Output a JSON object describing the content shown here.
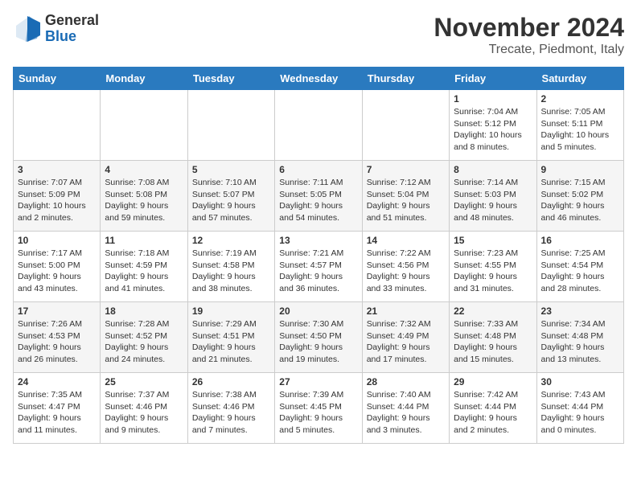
{
  "header": {
    "logo_line1": "General",
    "logo_line2": "Blue",
    "month_title": "November 2024",
    "location": "Trecate, Piedmont, Italy"
  },
  "days_of_week": [
    "Sunday",
    "Monday",
    "Tuesday",
    "Wednesday",
    "Thursday",
    "Friday",
    "Saturday"
  ],
  "weeks": [
    [
      {
        "day": "",
        "info": ""
      },
      {
        "day": "",
        "info": ""
      },
      {
        "day": "",
        "info": ""
      },
      {
        "day": "",
        "info": ""
      },
      {
        "day": "",
        "info": ""
      },
      {
        "day": "1",
        "info": "Sunrise: 7:04 AM\nSunset: 5:12 PM\nDaylight: 10 hours and 8 minutes."
      },
      {
        "day": "2",
        "info": "Sunrise: 7:05 AM\nSunset: 5:11 PM\nDaylight: 10 hours and 5 minutes."
      }
    ],
    [
      {
        "day": "3",
        "info": "Sunrise: 7:07 AM\nSunset: 5:09 PM\nDaylight: 10 hours and 2 minutes."
      },
      {
        "day": "4",
        "info": "Sunrise: 7:08 AM\nSunset: 5:08 PM\nDaylight: 9 hours and 59 minutes."
      },
      {
        "day": "5",
        "info": "Sunrise: 7:10 AM\nSunset: 5:07 PM\nDaylight: 9 hours and 57 minutes."
      },
      {
        "day": "6",
        "info": "Sunrise: 7:11 AM\nSunset: 5:05 PM\nDaylight: 9 hours and 54 minutes."
      },
      {
        "day": "7",
        "info": "Sunrise: 7:12 AM\nSunset: 5:04 PM\nDaylight: 9 hours and 51 minutes."
      },
      {
        "day": "8",
        "info": "Sunrise: 7:14 AM\nSunset: 5:03 PM\nDaylight: 9 hours and 48 minutes."
      },
      {
        "day": "9",
        "info": "Sunrise: 7:15 AM\nSunset: 5:02 PM\nDaylight: 9 hours and 46 minutes."
      }
    ],
    [
      {
        "day": "10",
        "info": "Sunrise: 7:17 AM\nSunset: 5:00 PM\nDaylight: 9 hours and 43 minutes."
      },
      {
        "day": "11",
        "info": "Sunrise: 7:18 AM\nSunset: 4:59 PM\nDaylight: 9 hours and 41 minutes."
      },
      {
        "day": "12",
        "info": "Sunrise: 7:19 AM\nSunset: 4:58 PM\nDaylight: 9 hours and 38 minutes."
      },
      {
        "day": "13",
        "info": "Sunrise: 7:21 AM\nSunset: 4:57 PM\nDaylight: 9 hours and 36 minutes."
      },
      {
        "day": "14",
        "info": "Sunrise: 7:22 AM\nSunset: 4:56 PM\nDaylight: 9 hours and 33 minutes."
      },
      {
        "day": "15",
        "info": "Sunrise: 7:23 AM\nSunset: 4:55 PM\nDaylight: 9 hours and 31 minutes."
      },
      {
        "day": "16",
        "info": "Sunrise: 7:25 AM\nSunset: 4:54 PM\nDaylight: 9 hours and 28 minutes."
      }
    ],
    [
      {
        "day": "17",
        "info": "Sunrise: 7:26 AM\nSunset: 4:53 PM\nDaylight: 9 hours and 26 minutes."
      },
      {
        "day": "18",
        "info": "Sunrise: 7:28 AM\nSunset: 4:52 PM\nDaylight: 9 hours and 24 minutes."
      },
      {
        "day": "19",
        "info": "Sunrise: 7:29 AM\nSunset: 4:51 PM\nDaylight: 9 hours and 21 minutes."
      },
      {
        "day": "20",
        "info": "Sunrise: 7:30 AM\nSunset: 4:50 PM\nDaylight: 9 hours and 19 minutes."
      },
      {
        "day": "21",
        "info": "Sunrise: 7:32 AM\nSunset: 4:49 PM\nDaylight: 9 hours and 17 minutes."
      },
      {
        "day": "22",
        "info": "Sunrise: 7:33 AM\nSunset: 4:48 PM\nDaylight: 9 hours and 15 minutes."
      },
      {
        "day": "23",
        "info": "Sunrise: 7:34 AM\nSunset: 4:48 PM\nDaylight: 9 hours and 13 minutes."
      }
    ],
    [
      {
        "day": "24",
        "info": "Sunrise: 7:35 AM\nSunset: 4:47 PM\nDaylight: 9 hours and 11 minutes."
      },
      {
        "day": "25",
        "info": "Sunrise: 7:37 AM\nSunset: 4:46 PM\nDaylight: 9 hours and 9 minutes."
      },
      {
        "day": "26",
        "info": "Sunrise: 7:38 AM\nSunset: 4:46 PM\nDaylight: 9 hours and 7 minutes."
      },
      {
        "day": "27",
        "info": "Sunrise: 7:39 AM\nSunset: 4:45 PM\nDaylight: 9 hours and 5 minutes."
      },
      {
        "day": "28",
        "info": "Sunrise: 7:40 AM\nSunset: 4:44 PM\nDaylight: 9 hours and 3 minutes."
      },
      {
        "day": "29",
        "info": "Sunrise: 7:42 AM\nSunset: 4:44 PM\nDaylight: 9 hours and 2 minutes."
      },
      {
        "day": "30",
        "info": "Sunrise: 7:43 AM\nSunset: 4:44 PM\nDaylight: 9 hours and 0 minutes."
      }
    ]
  ]
}
